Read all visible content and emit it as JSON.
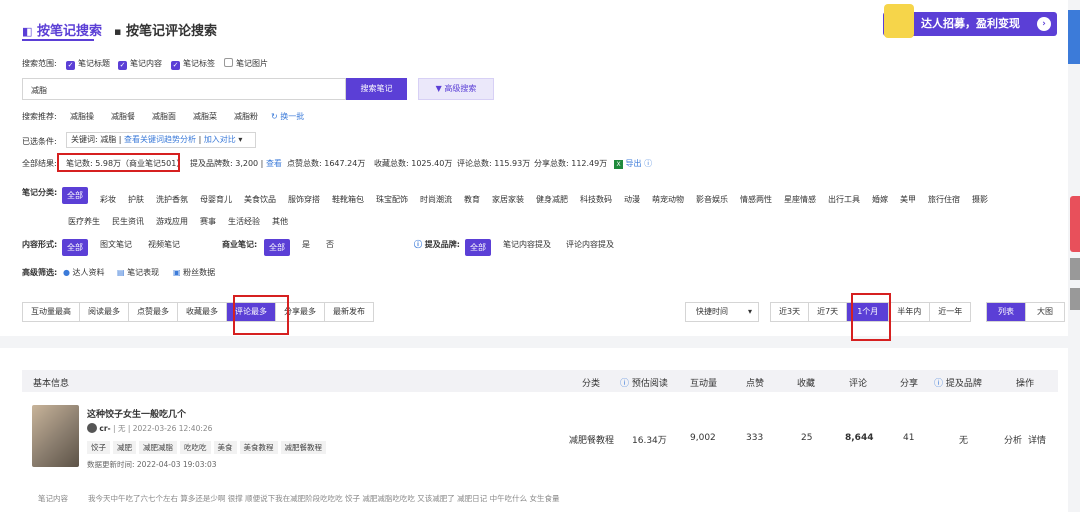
{
  "tabs": {
    "note_search": "按笔记搜索",
    "comment_search": "按笔记评论搜索"
  },
  "banner": {
    "text": "达人招募，盈利变现"
  },
  "scope": {
    "label": "搜索范围:",
    "options": [
      {
        "label": "笔记标题",
        "checked": true
      },
      {
        "label": "笔记内容",
        "checked": true
      },
      {
        "label": "笔记标签",
        "checked": true
      },
      {
        "label": "笔记图片",
        "checked": false
      }
    ]
  },
  "search": {
    "value": "减脂",
    "button": "搜索笔记",
    "advanced": "高级搜索"
  },
  "recommend": {
    "label": "搜索推荐:",
    "items": [
      "减脂操",
      "减脂餐",
      "减脂面",
      "减脂菜",
      "减脂粉"
    ],
    "refresh": "换一批"
  },
  "filters": {
    "label": "已选条件:",
    "keyword_text": "关键词: 减脂",
    "trend_link": "查看关键词趋势分析",
    "compare_link": "加入对比"
  },
  "results": {
    "label": "全部结果:",
    "notes_count": "笔记数: 5.98万（商业笔记501）",
    "brand_count_label": "提及品牌数: 3,200 |",
    "view": "查看",
    "likes": "点赞总数: 1647.24万",
    "collects": "收藏总数: 1025.40万",
    "comments": "评论总数: 115.93万",
    "shares": "分享总数: 112.49万",
    "export": "导出"
  },
  "categories": {
    "label": "笔记分类:",
    "all": "全部",
    "row1": [
      "彩妆",
      "护肤",
      "洗护香氛",
      "母婴育儿",
      "美食饮品",
      "服饰穿搭",
      "鞋靴箱包",
      "珠宝配饰",
      "时尚潮流",
      "教育",
      "家居家装",
      "健身减肥",
      "科技数码",
      "动漫",
      "萌宠动物",
      "影音娱乐",
      "情感两性",
      "星座情感",
      "出行工具",
      "婚嫁",
      "美甲",
      "旅行住宿",
      "摄影"
    ],
    "row2": [
      "医疗养生",
      "民生资讯",
      "游戏应用",
      "赛事",
      "生活经验",
      "其他"
    ]
  },
  "content_form": {
    "label": "内容形式:",
    "all": "全部",
    "items": [
      "图文笔记",
      "视频笔记"
    ]
  },
  "commercial": {
    "label": "商业笔记:",
    "all": "全部",
    "items": [
      "是",
      "否"
    ]
  },
  "brand_mention": {
    "label": "提及品牌:",
    "all": "全部",
    "items": [
      "笔记内容提及",
      "评论内容提及"
    ]
  },
  "advanced_filter": {
    "label": "高级筛选:",
    "items": [
      "达人资料",
      "笔记表现",
      "粉丝数据"
    ]
  },
  "sort": {
    "items": [
      "互动量最高",
      "阅读最多",
      "点赞最多",
      "收藏最多",
      "评论最多",
      "分享最多",
      "最新发布"
    ],
    "active": "评论最多"
  },
  "time": {
    "select": "快捷时间",
    "items": [
      "近3天",
      "近7天",
      "1个月",
      "半年内",
      "近一年"
    ],
    "active": "1个月"
  },
  "view_mode": {
    "items": [
      "列表",
      "大图"
    ],
    "active": "列表"
  },
  "table": {
    "headers": [
      "基本信息",
      "分类",
      "预估阅读",
      "互动量",
      "点赞",
      "收藏",
      "评论",
      "分享",
      "提及品牌",
      "操作"
    ],
    "row": {
      "title": "这种饺子女生一般吃几个",
      "author": "cr-",
      "author_meta": "无 | 2022-03-26 12:40:26",
      "tags": [
        "饺子",
        "减肥",
        "减肥减脂",
        "吃吃吃",
        "美食",
        "美食教程",
        "减肥餐教程"
      ],
      "updated": "数据更新时间:  2022-04-03 19:03:03",
      "category": "减肥餐教程",
      "reads": "16.34万",
      "interactions": "9,002",
      "likes": "333",
      "collects": "25",
      "comments": "8,644",
      "shares": "41",
      "brand": "无",
      "action_analyze": "分析",
      "action_detail": "详情"
    },
    "content_label": "笔记内容",
    "content_text": "我今天中午吃了六七个左右 算多还是少啊 很撑 顺便说下我在减肥阶段吃吃吃 饺子 减肥减脂吃吃吃 又该减肥了 减肥日记 中午吃什么 女生食量"
  },
  "colors": {
    "accent": "#5b3fd6",
    "link": "#3c7bd9",
    "highlight_box": "#d62020"
  }
}
